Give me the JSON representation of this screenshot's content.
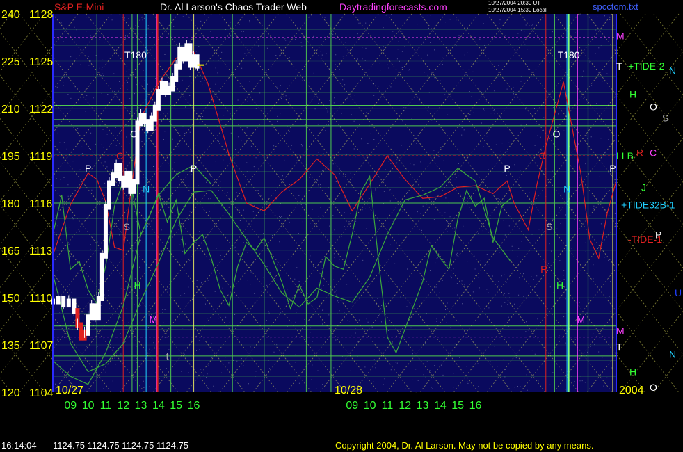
{
  "header": {
    "instrument": "S&P E-Mini",
    "title": "Dr. Al Larson's Chaos Trader Web",
    "site": "Daytradingforecasts.com",
    "stamp_line1": "10/27/2004 20:30 UT",
    "stamp_line2": "10/27/2004 15:30 Local",
    "file": "spcctom.txt"
  },
  "footer": {
    "time": "16:14:04",
    "quote": "1124.75 1124.75 1124.75 1124.75",
    "copyright": "Copyright 2004, Dr. Al Larson. May not be copied by any means."
  },
  "colors": {
    "background": "#000000",
    "plot_bg": "#0a0a5e",
    "grid_yellow": "#e8e860",
    "grid_green": "#4fc94f",
    "price_white": "#ffffff",
    "red_line": "#e02020",
    "green_osc": "#3ca83c",
    "axis_yellow": "#ffff00",
    "hour_green": "#33ff33",
    "magenta": "#ff40ff",
    "cyan": "#20d0ff"
  },
  "chart_data": {
    "type": "candlestick",
    "ylim": [
      1104,
      1128
    ],
    "left_scale_ticks": [
      {
        "a": "240",
        "b": "1128"
      },
      {
        "a": "225",
        "b": "1125"
      },
      {
        "a": "210",
        "b": "1122"
      },
      {
        "a": "195",
        "b": "1119"
      },
      {
        "a": "180",
        "b": "1116"
      },
      {
        "a": "165",
        "b": "1113"
      },
      {
        "a": "150",
        "b": "1110"
      },
      {
        "a": "135",
        "b": "1107"
      },
      {
        "a": "120",
        "b": "1104"
      }
    ],
    "hour_ticks": [
      "09",
      "10",
      "11",
      "12",
      "13",
      "14",
      "15",
      "16",
      "09",
      "10",
      "11",
      "12",
      "13",
      "14",
      "15",
      "16"
    ],
    "date_labels": [
      "10/27",
      "10/28",
      "2004"
    ],
    "right_labels": [
      {
        "text": "M",
        "color": "#ff40ff",
        "y": 1126.6
      },
      {
        "text": "T",
        "color": "#ffffff",
        "y": 1124.7
      },
      {
        "text": "+TIDE-2",
        "color": "#33ff33",
        "y": 1124.7
      },
      {
        "text": "N",
        "color": "#20d0ff",
        "y": 1124.4
      },
      {
        "text": "H",
        "color": "#33ff33",
        "y": 1122.9
      },
      {
        "text": "O",
        "color": "#ffffff",
        "y": 1122.1
      },
      {
        "text": "S",
        "color": "#aaaaaa",
        "y": 1121.4
      },
      {
        "text": "LLB",
        "color": "#33ff33",
        "y": 1119.0
      },
      {
        "text": "R",
        "color": "#e02020",
        "y": 1119.2
      },
      {
        "text": "C",
        "color": "#ff40ff",
        "y": 1119.2
      },
      {
        "text": "J",
        "color": "#33ff33",
        "y": 1117.0
      },
      {
        "text": "+TIDE32B-1",
        "color": "#20d0ff",
        "y": 1115.9
      },
      {
        "text": "P",
        "color": "#ffffff",
        "y": 1114.0
      },
      {
        "text": "-TIDE-1",
        "color": "#e02020",
        "y": 1113.7
      },
      {
        "text": "U",
        "color": "#2040ff",
        "y": 1110.3
      },
      {
        "text": "M",
        "color": "#ff40ff",
        "y": 1107.9
      },
      {
        "text": "T",
        "color": "#ffffff",
        "y": 1106.9
      },
      {
        "text": "N",
        "color": "#20d0ff",
        "y": 1106.4
      },
      {
        "text": "H",
        "color": "#33ff33",
        "y": 1105.3
      },
      {
        "text": "O",
        "color": "#ffffff",
        "y": 1104.3
      }
    ],
    "plot_labels": [
      {
        "text": "T180",
        "color": "#ffffff",
        "hour": 12.7,
        "y": 1125.4
      },
      {
        "text": "T180",
        "color": "#ffffff",
        "hour": 37.3,
        "y": 1125.4
      },
      {
        "text": "P",
        "color": "#ffffff",
        "hour": 10.0,
        "y": 1118.2
      },
      {
        "text": "P",
        "color": "#ffffff",
        "hour": 16.0,
        "y": 1118.2
      },
      {
        "text": "P",
        "color": "#ffffff",
        "hour": 33.8,
        "y": 1118.2
      },
      {
        "text": "P",
        "color": "#ffffff",
        "hour": 39.8,
        "y": 1118.2
      },
      {
        "text": "O",
        "color": "#ffffff",
        "hour": 12.6,
        "y": 1120.4
      },
      {
        "text": "O",
        "color": "#ffffff",
        "hour": 36.6,
        "y": 1120.4
      },
      {
        "text": "C",
        "color": "#e02020",
        "hour": 11.8,
        "y": 1119.0
      },
      {
        "text": "C",
        "color": "#e02020",
        "hour": 35.8,
        "y": 1119.0
      },
      {
        "text": "N",
        "color": "#20d0ff",
        "hour": 13.3,
        "y": 1116.9
      },
      {
        "text": "N",
        "color": "#20d0ff",
        "hour": 37.2,
        "y": 1116.9
      },
      {
        "text": "S",
        "color": "#aaaaaa",
        "hour": 12.2,
        "y": 1114.5
      },
      {
        "text": "S",
        "color": "#aaaaaa",
        "hour": 36.2,
        "y": 1114.5
      },
      {
        "text": "R",
        "color": "#e02020",
        "hour": 35.9,
        "y": 1111.8
      },
      {
        "text": "H",
        "color": "#33ff33",
        "hour": 12.8,
        "y": 1110.8
      },
      {
        "text": "H",
        "color": "#33ff33",
        "hour": 36.8,
        "y": 1110.8
      },
      {
        "text": "M",
        "color": "#ff40ff",
        "hour": 13.7,
        "y": 1108.6
      },
      {
        "text": "M",
        "color": "#ff40ff",
        "hour": 38.0,
        "y": 1108.6
      },
      {
        "text": "t",
        "color": "#aaaaaa",
        "hour": 14.5,
        "y": 1106.3
      }
    ],
    "series": [
      {
        "name": "S&P E-Mini",
        "color": "#ffffff",
        "x": [
          8.0,
          8.3,
          8.6,
          8.9,
          9.2,
          9.4,
          9.6,
          9.8,
          10.0,
          10.2,
          10.4,
          10.6,
          10.8,
          11.0,
          11.2,
          11.4,
          11.6,
          11.8,
          12.0,
          12.2,
          12.4,
          12.6,
          12.8,
          13.0,
          13.2,
          13.4,
          13.6,
          13.8,
          14.0,
          14.2,
          14.4,
          14.6,
          14.8,
          15.0,
          15.2,
          15.4,
          15.6,
          15.8,
          16.0,
          16.2
        ],
        "y": [
          1109.8,
          1110.0,
          1109.6,
          1109.8,
          1109.2,
          1108.3,
          1107.5,
          1107.8,
          1108.8,
          1109.5,
          1108.8,
          1110.0,
          1112.7,
          1115.8,
          1117.3,
          1117.8,
          1118.4,
          1117.6,
          1117.2,
          1117.9,
          1116.8,
          1117.4,
          1121.1,
          1121.6,
          1121.2,
          1120.8,
          1121.4,
          1122.1,
          1123.1,
          1123.6,
          1123.1,
          1123.3,
          1123.9,
          1124.7,
          1125.8,
          1125.2,
          1126.0,
          1124.8,
          1125.3,
          1124.75
        ]
      },
      {
        "name": "red cycle",
        "color": "#e02020",
        "x": [
          8,
          9,
          10,
          10.5,
          11,
          11.5,
          12,
          12.5,
          13,
          14,
          15,
          16,
          16.8,
          17.5,
          18,
          19,
          20,
          21,
          22,
          23,
          24,
          25,
          26,
          27,
          28,
          29,
          30,
          31,
          32,
          33,
          33.8,
          34.2,
          35,
          35.5,
          36,
          37,
          38,
          38.5,
          39,
          39.5,
          40
        ],
        "y": [
          1112.7,
          1115.9,
          1117.9,
          1117.5,
          1116.1,
          1113.2,
          1113.0,
          1117.3,
          1121.4,
          1123.6,
          1125.2,
          1125.6,
          1123.6,
          1121.0,
          1119.1,
          1116.0,
          1115.5,
          1116.7,
          1117.5,
          1118.8,
          1117.8,
          1115.5,
          1117.2,
          1119.0,
          1117.5,
          1116.3,
          1116.4,
          1117.0,
          1117.1,
          1116.6,
          1117.4,
          1116.0,
          1114.3,
          1117.2,
          1119.6,
          1123.7,
          1117.8,
          1113.7,
          1112.5,
          1115.4,
          1117.4
        ]
      },
      {
        "name": "green oscillator",
        "color": "#3ca83c",
        "x": [
          8,
          8.5,
          9,
          9.5,
          10,
          10.5,
          11,
          11.5,
          12,
          12.5,
          13,
          13.5,
          14,
          14.5,
          15,
          15.5,
          16,
          16.5,
          17,
          17.5,
          18,
          18.5,
          19,
          19.5,
          20,
          20.5,
          21,
          21.5,
          22,
          22.5,
          23,
          23.5,
          24,
          24.5,
          25,
          25.5,
          26,
          26.5,
          27,
          27.5,
          28,
          28.5,
          29,
          29.5,
          30,
          30.5,
          31,
          31.5,
          32,
          32.5,
          33,
          33.5,
          34
        ],
        "y": [
          1114.0,
          1116.5,
          1111.8,
          1112.3,
          1110.5,
          1109.6,
          1112.0,
          1115.8,
          1117.4,
          1116.8,
          1114.0,
          1115.2,
          1116.6,
          1114.8,
          1116.2,
          1112.8,
          1113.5,
          1114.0,
          1112.5,
          1110.5,
          1109.5,
          1112.0,
          1113.5,
          1113.0,
          1113.8,
          1112.4,
          1111.0,
          1109.3,
          1110.8,
          1109.6,
          1110.0,
          1112.6,
          1112.0,
          1111.8,
          1114.0,
          1116.7,
          1117.7,
          1112.3,
          1107.5,
          1106.5,
          1108.0,
          1109.5,
          1111.0,
          1113.3,
          1112.5,
          1111.8,
          1115.0,
          1116.8,
          1115.8,
          1116.3,
          1113.5,
          1115.8,
          1116.3
        ]
      },
      {
        "name": "green envelope",
        "color": "#3ca83c",
        "x": [
          8,
          9,
          10,
          11,
          12,
          13,
          14,
          15,
          16,
          17,
          18,
          19,
          20,
          21,
          22,
          23,
          24,
          25,
          26,
          27,
          28,
          29,
          30,
          31,
          32,
          33,
          34
        ],
        "y": [
          1111.5,
          1107.1,
          1105.3,
          1105.8,
          1107.1,
          1109.8,
          1112.2,
          1114.9,
          1116.7,
          1116.8,
          1115.3,
          1113.7,
          1112.1,
          1110.3,
          1109.4,
          1110.6,
          1110.1,
          1109.7,
          1111.3,
          1114.0,
          1116.2,
          1116.5,
          1117.0,
          1118.2,
          1117.4,
          1113.8,
          1112.3
        ]
      },
      {
        "name": "green envelope 2",
        "color": "#3ca83c",
        "x": [
          8,
          9,
          10,
          11,
          12,
          13,
          14,
          15,
          16,
          17
        ],
        "y": [
          1106.0,
          1105.0,
          1104.5,
          1106.5,
          1109.5,
          1114.0,
          1116.5,
          1117.8,
          1118.4,
          1117.2
        ]
      }
    ]
  }
}
